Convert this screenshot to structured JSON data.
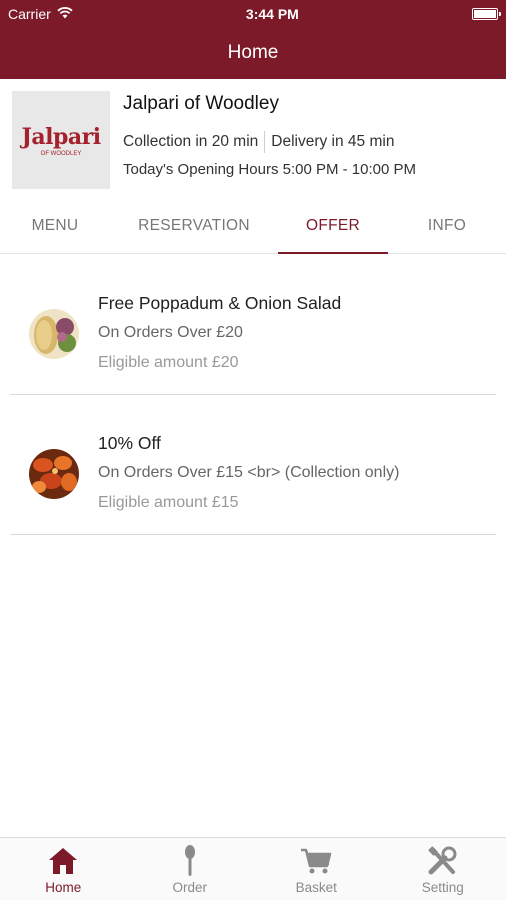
{
  "status_bar": {
    "carrier": "Carrier",
    "time": "3:44 PM"
  },
  "nav": {
    "title": "Home"
  },
  "restaurant": {
    "logo_text": "Jalpari",
    "logo_subtext": "OF WOODLEY",
    "name": "Jalpari of Woodley",
    "collection": "Collection in 20 min",
    "delivery": "Delivery in 45 min",
    "hours": "Today's Opening Hours 5:00 PM - 10:00 PM"
  },
  "tabs": [
    {
      "label": "MENU",
      "active": false
    },
    {
      "label": "RESERVATION",
      "active": false
    },
    {
      "label": "OFFER",
      "active": true
    },
    {
      "label": "INFO",
      "active": false
    }
  ],
  "offers": [
    {
      "title": "Free Poppadum & Onion Salad",
      "condition": "On Orders Over £20",
      "eligible": "Eligible amount £20",
      "icon": "poppadum-image"
    },
    {
      "title": "10% Off",
      "condition": "On Orders Over £15 <br> (Collection only)",
      "eligible": "Eligible amount £15",
      "icon": "chicken-wings-image"
    }
  ],
  "bottom_nav": [
    {
      "label": "Home",
      "icon": "home-icon",
      "active": true
    },
    {
      "label": "Order",
      "icon": "spoon-icon",
      "active": false
    },
    {
      "label": "Basket",
      "icon": "cart-icon",
      "active": false
    },
    {
      "label": "Setting",
      "icon": "tools-icon",
      "active": false
    }
  ],
  "colors": {
    "brand": "#7d1a2a",
    "inactive": "#8a8a8a",
    "divider": "#d9d9d9"
  }
}
